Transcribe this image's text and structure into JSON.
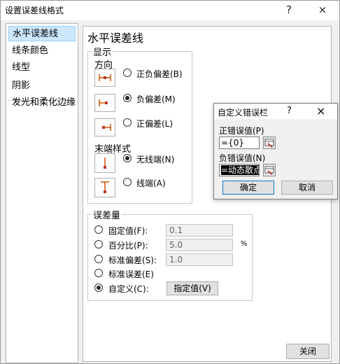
{
  "window": {
    "title": "设置误差线格式",
    "help": "?",
    "close": "×"
  },
  "sidebar": {
    "items": [
      {
        "label": "水平误差线"
      },
      {
        "label": "线条颜色"
      },
      {
        "label": "线型"
      },
      {
        "label": "阴影"
      },
      {
        "label": "发光和柔化边缘"
      }
    ]
  },
  "panel": {
    "heading": "水平误差线",
    "display_group": "显示",
    "direction_label": "方向",
    "direction_options": [
      "正负偏差(B)",
      "负偏差(M)",
      "正偏差(L)"
    ],
    "direction_selected": "负偏差(M)",
    "endstyle_label": "末端样式",
    "endstyle_options": [
      "无线端(N)",
      "线端(A)"
    ],
    "endstyle_selected": "无线端(N)",
    "amount_group": "误差量",
    "amount_options": [
      {
        "label": "固定值(F):",
        "value": "0.1"
      },
      {
        "label": "百分比(P):",
        "value": "5.0",
        "unit": "%"
      },
      {
        "label": "标准偏差(S):",
        "value": "1.0"
      },
      {
        "label": "标准误差(E)"
      },
      {
        "label": "自定义(C):"
      }
    ],
    "amount_selected": "自定义(C):",
    "specify_button": "指定值(V)",
    "close_button": "关闭"
  },
  "popup": {
    "title": "自定义错误栏",
    "help": "?",
    "close": "×",
    "positive_label": "正错误值(P)",
    "positive_value": "={0}",
    "negative_label": "负错误值(N)",
    "negative_value": "=动态散点",
    "ok": "确定",
    "cancel": "取消"
  },
  "colors": {
    "accent_selected": "#cce8ff",
    "arrow_red": "#c0392b",
    "icon_orange": "#d35400"
  }
}
